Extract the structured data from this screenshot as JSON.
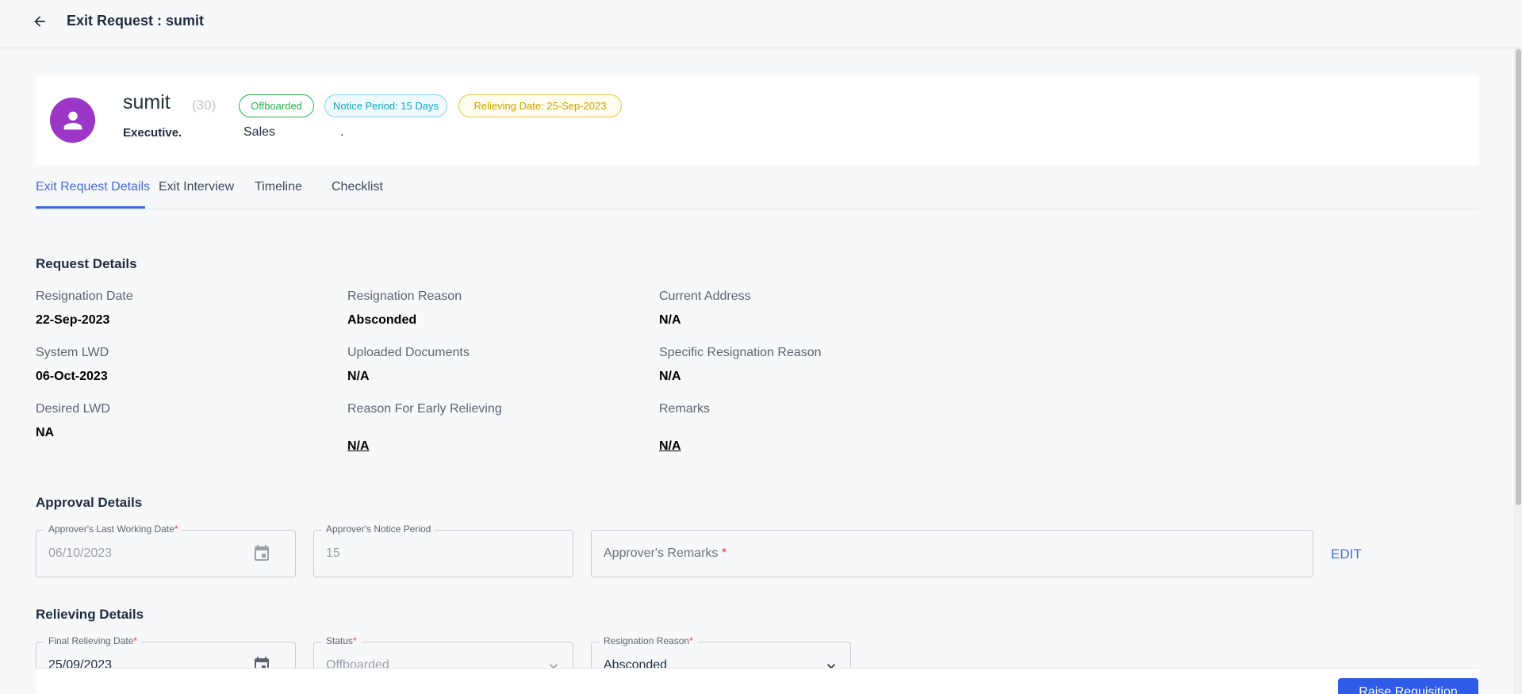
{
  "header": {
    "title": "Exit Request : sumit"
  },
  "employee": {
    "name": "sumit",
    "id": "(30)",
    "designation": "Executive.",
    "department": "Sales",
    "location": ".",
    "badges": {
      "status": "Offboarded",
      "notice_period": "Notice Period: 15 Days",
      "relieving_date": "Relieving Date: 25-Sep-2023"
    }
  },
  "tabs": [
    {
      "label": "Exit Request Details",
      "active": true
    },
    {
      "label": "Exit Interview",
      "active": false
    },
    {
      "label": "Timeline",
      "active": false
    },
    {
      "label": "Checklist",
      "active": false
    }
  ],
  "request_details": {
    "title": "Request Details",
    "fields": [
      {
        "label": "Resignation Date",
        "value": "22-Sep-2023"
      },
      {
        "label": "Resignation Reason",
        "value": "Absconded"
      },
      {
        "label": "Current Address",
        "value": "N/A"
      },
      {
        "label": "System LWD",
        "value": "06-Oct-2023"
      },
      {
        "label": "Uploaded Documents",
        "value": "N/A"
      },
      {
        "label": "Specific Resignation Reason",
        "value": "N/A"
      },
      {
        "label": "Desired LWD",
        "value": "NA"
      },
      {
        "label": "Reason For Early Relieving",
        "value": "N/A"
      },
      {
        "label": "Remarks",
        "value": "N/A"
      }
    ]
  },
  "approval_details": {
    "title": "Approval Details",
    "last_working_date_label": "Approver's Last Working Date",
    "last_working_date_value": "06/10/2023",
    "notice_period_label": "Approver's Notice Period",
    "notice_period_value": "15",
    "remarks_placeholder": "Approver's Remarks",
    "edit_label": "EDIT"
  },
  "relieving_details": {
    "title": "Relieving Details",
    "final_relieving_date_label": "Final Relieving Date",
    "final_relieving_date_value": "25/09/2023",
    "status_label": "Status",
    "status_value": "Offboarded",
    "resignation_reason_label": "Resignation Reason",
    "resignation_reason_value": "Absconded"
  },
  "footer": {
    "raise_label": "Raise Requisition"
  },
  "colors": {
    "accent": "#4169e1",
    "avatar": "#9c36c7",
    "offboarded": "#29b44a",
    "notice": "#16a3c6",
    "relieving": "#c9a100",
    "primary_button": "#2f5be7"
  }
}
